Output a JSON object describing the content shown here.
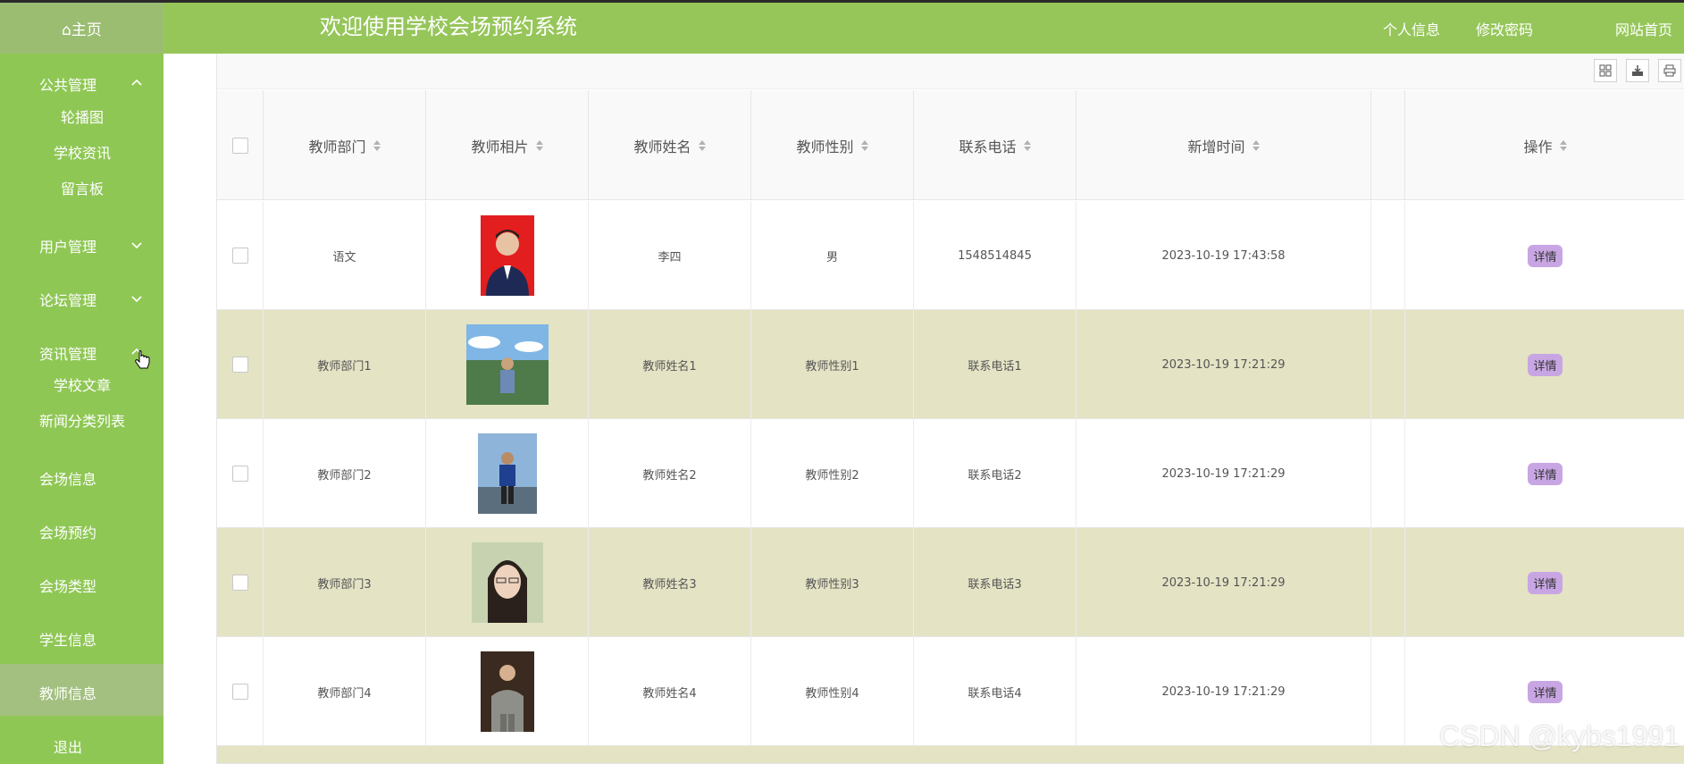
{
  "header": {
    "home": "⌂主页",
    "title": "欢迎使用学校会场预约系统",
    "links": [
      "个人信息",
      "修改密码",
      "网站首页"
    ]
  },
  "sidebar": {
    "groups": [
      {
        "label": "公共管理",
        "expanded": true,
        "items": [
          "轮播图",
          "学校资讯",
          "留言板"
        ]
      },
      {
        "label": "用户管理",
        "expanded": false
      },
      {
        "label": "论坛管理",
        "expanded": false
      },
      {
        "label": "资讯管理",
        "expanded": true,
        "items": [
          "学校文章",
          "新闻分类列表"
        ]
      }
    ],
    "items": [
      "会场信息",
      "会场预约",
      "会场类型",
      "学生信息",
      "教师信息",
      "退出"
    ],
    "active": "教师信息"
  },
  "table": {
    "columns": [
      "教师部门",
      "教师相片",
      "教师姓名",
      "教师性别",
      "联系电话",
      "新增时间",
      "操作"
    ],
    "action_label": "详情",
    "rows": [
      {
        "dept": "语文",
        "name": "李四",
        "gender": "男",
        "phone": "1548514845",
        "time": "2023-10-19 17:43:58"
      },
      {
        "dept": "教师部门1",
        "name": "教师姓名1",
        "gender": "教师性别1",
        "phone": "联系电话1",
        "time": "2023-10-19 17:21:29"
      },
      {
        "dept": "教师部门2",
        "name": "教师姓名2",
        "gender": "教师性别2",
        "phone": "联系电话2",
        "time": "2023-10-19 17:21:29"
      },
      {
        "dept": "教师部门3",
        "name": "教师姓名3",
        "gender": "教师性别3",
        "phone": "联系电话3",
        "time": "2023-10-19 17:21:29"
      },
      {
        "dept": "教师部门4",
        "name": "教师姓名4",
        "gender": "教师性别4",
        "phone": "联系电话4",
        "time": "2023-10-19 17:21:29"
      }
    ]
  },
  "watermark": "CSDN @kybs1991",
  "colors": {
    "header": "#96c65a",
    "sidebar": "#8fc755",
    "row_alt": "#e4e3c4",
    "detail_btn": "#c8a6e3"
  }
}
